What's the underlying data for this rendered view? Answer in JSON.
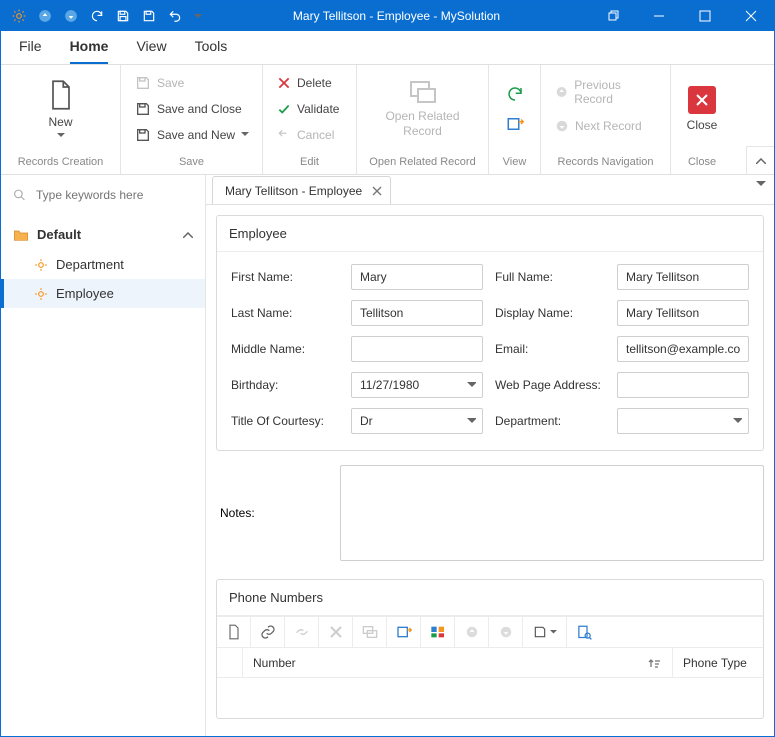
{
  "titlebar": {
    "title": "Mary Tellitson - Employee - MySolution"
  },
  "menu": {
    "file": "File",
    "home": "Home",
    "view": "View",
    "tools": "Tools"
  },
  "ribbon": {
    "new": "New",
    "records_creation": "Records Creation",
    "save": "Save",
    "save_and_close": "Save and Close",
    "save_and_new": "Save and New",
    "save_group": "Save",
    "delete_": "Delete",
    "validate": "Validate",
    "cancel": "Cancel",
    "edit_group": "Edit",
    "open_related": "Open Related Record",
    "open_related_group": "Open Related Record",
    "view_group": "View",
    "prev_record": "Previous Record",
    "next_record": "Next Record",
    "records_nav_group": "Records Navigation",
    "close": "Close",
    "close_group": "Close"
  },
  "search": {
    "placeholder": "Type keywords here"
  },
  "tree": {
    "folder": "Default",
    "department": "Department",
    "employee": "Employee"
  },
  "doc_tab": {
    "label": "Mary Tellitson - Employee"
  },
  "panel": {
    "employee_header": "Employee",
    "phone_header": "Phone Numbers"
  },
  "form": {
    "first_name_label": "First Name:",
    "first_name": "Mary",
    "full_name_label": "Full Name:",
    "full_name": "Mary Tellitson",
    "last_name_label": "Last Name:",
    "last_name": "Tellitson",
    "display_name_label": "Display Name:",
    "display_name": "Mary Tellitson",
    "middle_name_label": "Middle Name:",
    "middle_name": "",
    "email_label": "Email:",
    "email": "tellitson@example.com",
    "birthday_label": "Birthday:",
    "birthday": "11/27/1980",
    "web_label": "Web Page Address:",
    "web": "",
    "title_label": "Title Of Courtesy:",
    "title": "Dr",
    "department_label": "Department:",
    "department": "",
    "notes_label": "Notes:",
    "notes": ""
  },
  "grid": {
    "number": "Number",
    "phone_type": "Phone Type"
  }
}
